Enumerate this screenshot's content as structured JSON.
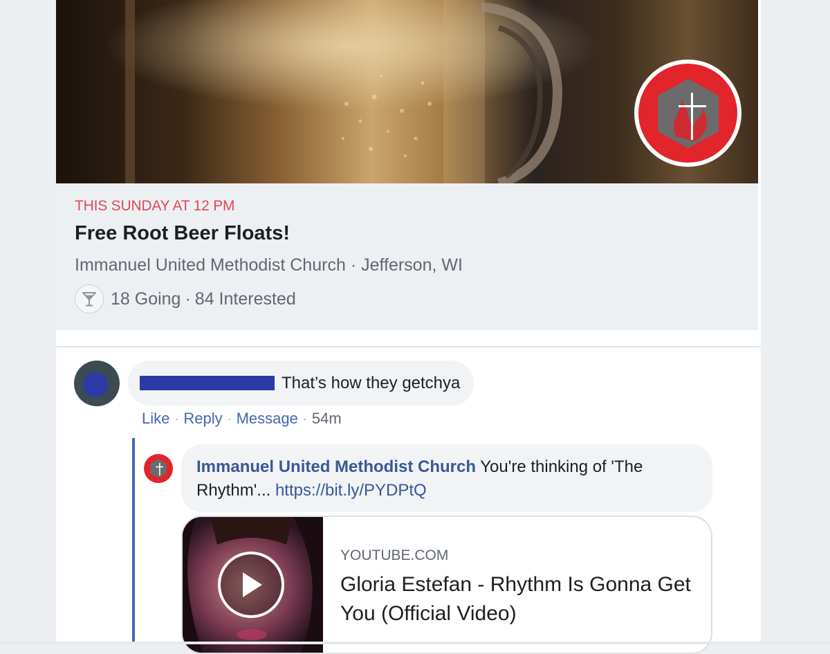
{
  "event": {
    "date": "THIS SUNDAY AT 12 PM",
    "title": "Free Root Beer Floats!",
    "host": "Immanuel United Methodist Church",
    "location": "Jefferson, WI",
    "going": "18 Going",
    "interested": "84 Interested",
    "stats_icon": "cocktail-glass-icon",
    "badge_icon": "methodist-cross-flame-logo"
  },
  "comment": {
    "text": "That’s how they getchya",
    "actions": {
      "like": "Like",
      "reply": "Reply",
      "message": "Message",
      "time": "54m"
    }
  },
  "reply": {
    "author": "Immanuel United Methodist Church",
    "text": "You're thinking of 'The Rhythm'...",
    "url": "https://bit.ly/PYDPtQ"
  },
  "link_preview": {
    "domain": "YOUTUBE.COM",
    "title": "Gloria Estefan - Rhythm Is Gonna Get You (Official Video)",
    "icon": "play-icon"
  },
  "colors": {
    "date_red": "#e04857",
    "link_blue": "#4267b2",
    "badge_red": "#e2242b",
    "redaction": "#2c3aa6"
  },
  "separator": "·"
}
